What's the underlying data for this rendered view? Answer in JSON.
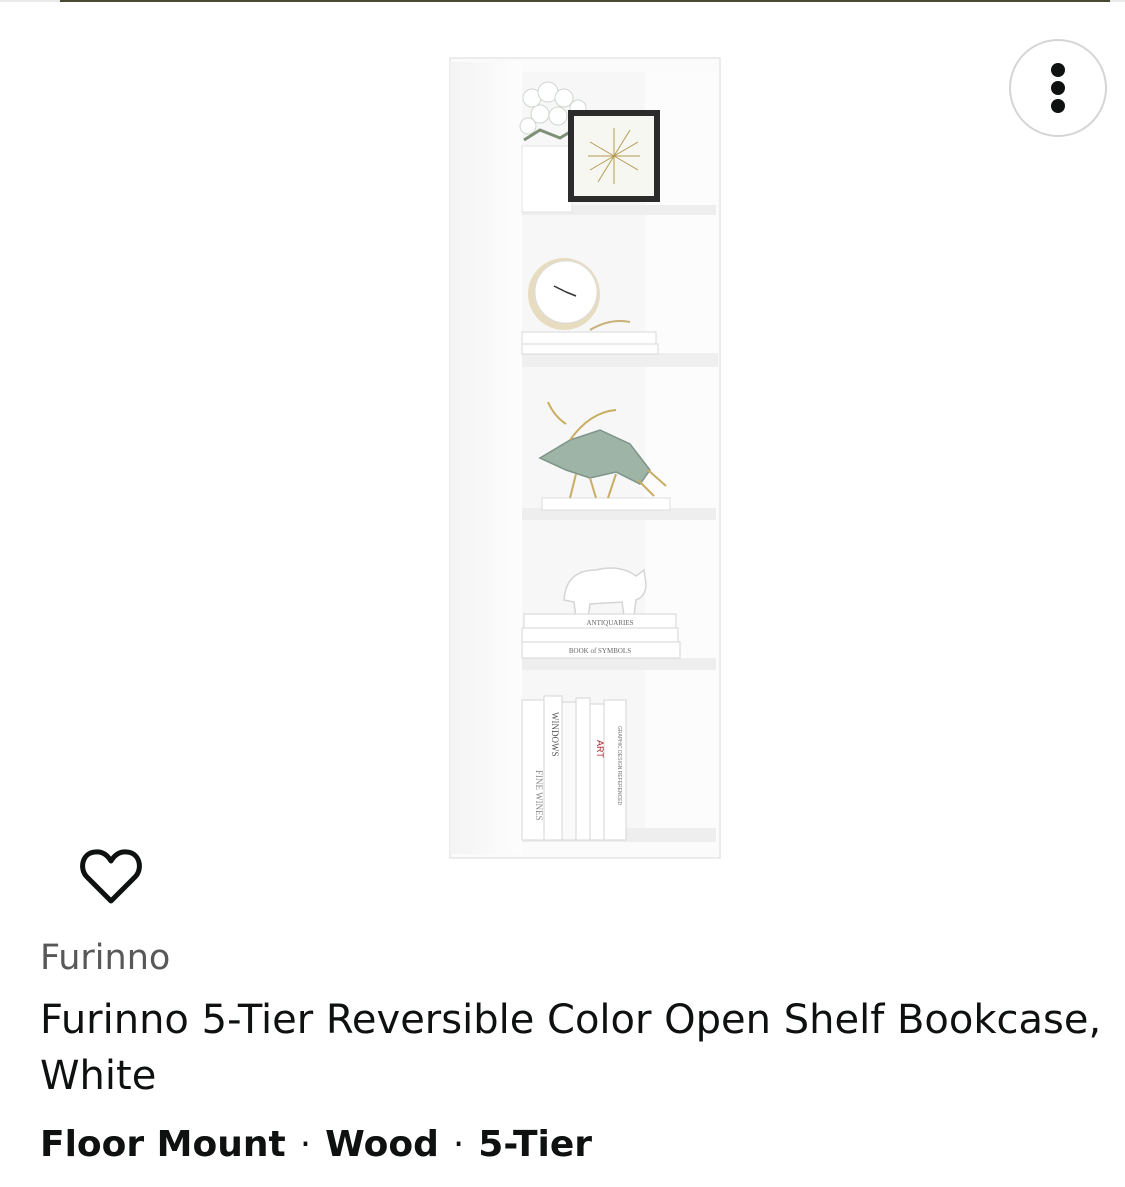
{
  "product": {
    "brand": "Furinno",
    "title": "Furinno 5-Tier Reversible Color Open Shelf Bookcase, White",
    "attributes": [
      "Floor Mount",
      "Wood",
      "5-Tier"
    ],
    "attribute_separator": "·",
    "image_book_spines": [
      "WINDOWS",
      "FINE WINES",
      "ART",
      "ANTIQUARIES",
      "BOOK of SYMBOLS",
      "GRAPHIC DESIGN REFERENCED"
    ]
  },
  "icons": {
    "more": "more-vertical-icon",
    "wishlist": "heart-outline-icon"
  },
  "colors": {
    "text_primary": "#0f1111",
    "text_secondary": "#585858",
    "button_border": "#d5d5d5"
  }
}
